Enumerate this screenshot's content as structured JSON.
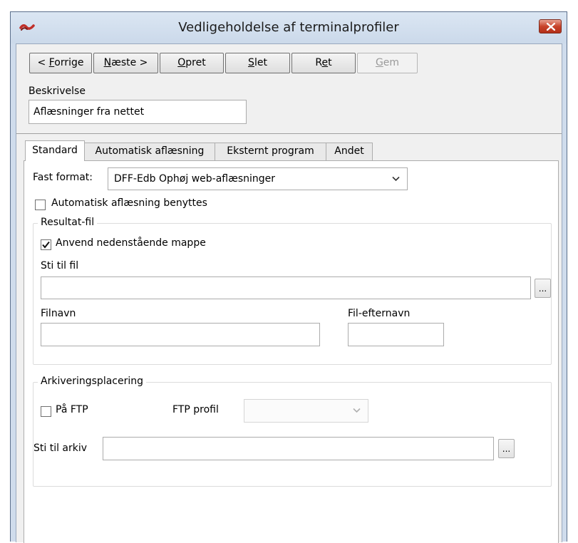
{
  "window": {
    "title": "Vedligeholdelse af terminalprofiler"
  },
  "toolbar": {
    "prev": {
      "before": "< ",
      "mn": "F",
      "after": "orrige"
    },
    "next": {
      "before": "",
      "mn": "N",
      "after": "æste >"
    },
    "create": {
      "before": "",
      "mn": "O",
      "after": "pret"
    },
    "delete": {
      "before": "",
      "mn": "S",
      "after": "let"
    },
    "edit": {
      "before": "R",
      "mn": "e",
      "after": "t"
    },
    "save": {
      "before": "",
      "mn": "G",
      "after": "em"
    }
  },
  "description": {
    "label": "Beskrivelse",
    "value": "Aflæsninger fra nettet"
  },
  "tabs": [
    "Standard",
    "Automatisk aflæsning",
    "Eksternt program",
    "Andet"
  ],
  "standard": {
    "fixed_format_label": "Fast format:",
    "fixed_format_value": "DFF-Edb Ophøj web-aflæsninger",
    "auto_reading_label": "Automatisk aflæsning benyttes",
    "auto_reading_checked": false,
    "result_file": {
      "title": "Resultat-fil",
      "use_folder_label": "Anvend nedenstående mappe",
      "use_folder_checked": true,
      "path_label": "Sti til fil",
      "path_value": "",
      "browse_label": "...",
      "filename_label": "Filnavn",
      "filename_value": "",
      "extension_label": "Fil-efternavn",
      "extension_value": ""
    },
    "archive": {
      "title": "Arkiveringsplacering",
      "ftp_label": "På FTP",
      "ftp_checked": false,
      "ftp_profile_label": "FTP profil",
      "ftp_profile_value": "",
      "archive_path_label": "Sti til arkiv",
      "archive_path_value": "",
      "browse_label": "..."
    }
  },
  "colors": {
    "title_bar": "#cfdcec",
    "close_button": "#c8442b",
    "panel_bg": "#ffffff",
    "dialog_bg": "#f0f0f0"
  }
}
